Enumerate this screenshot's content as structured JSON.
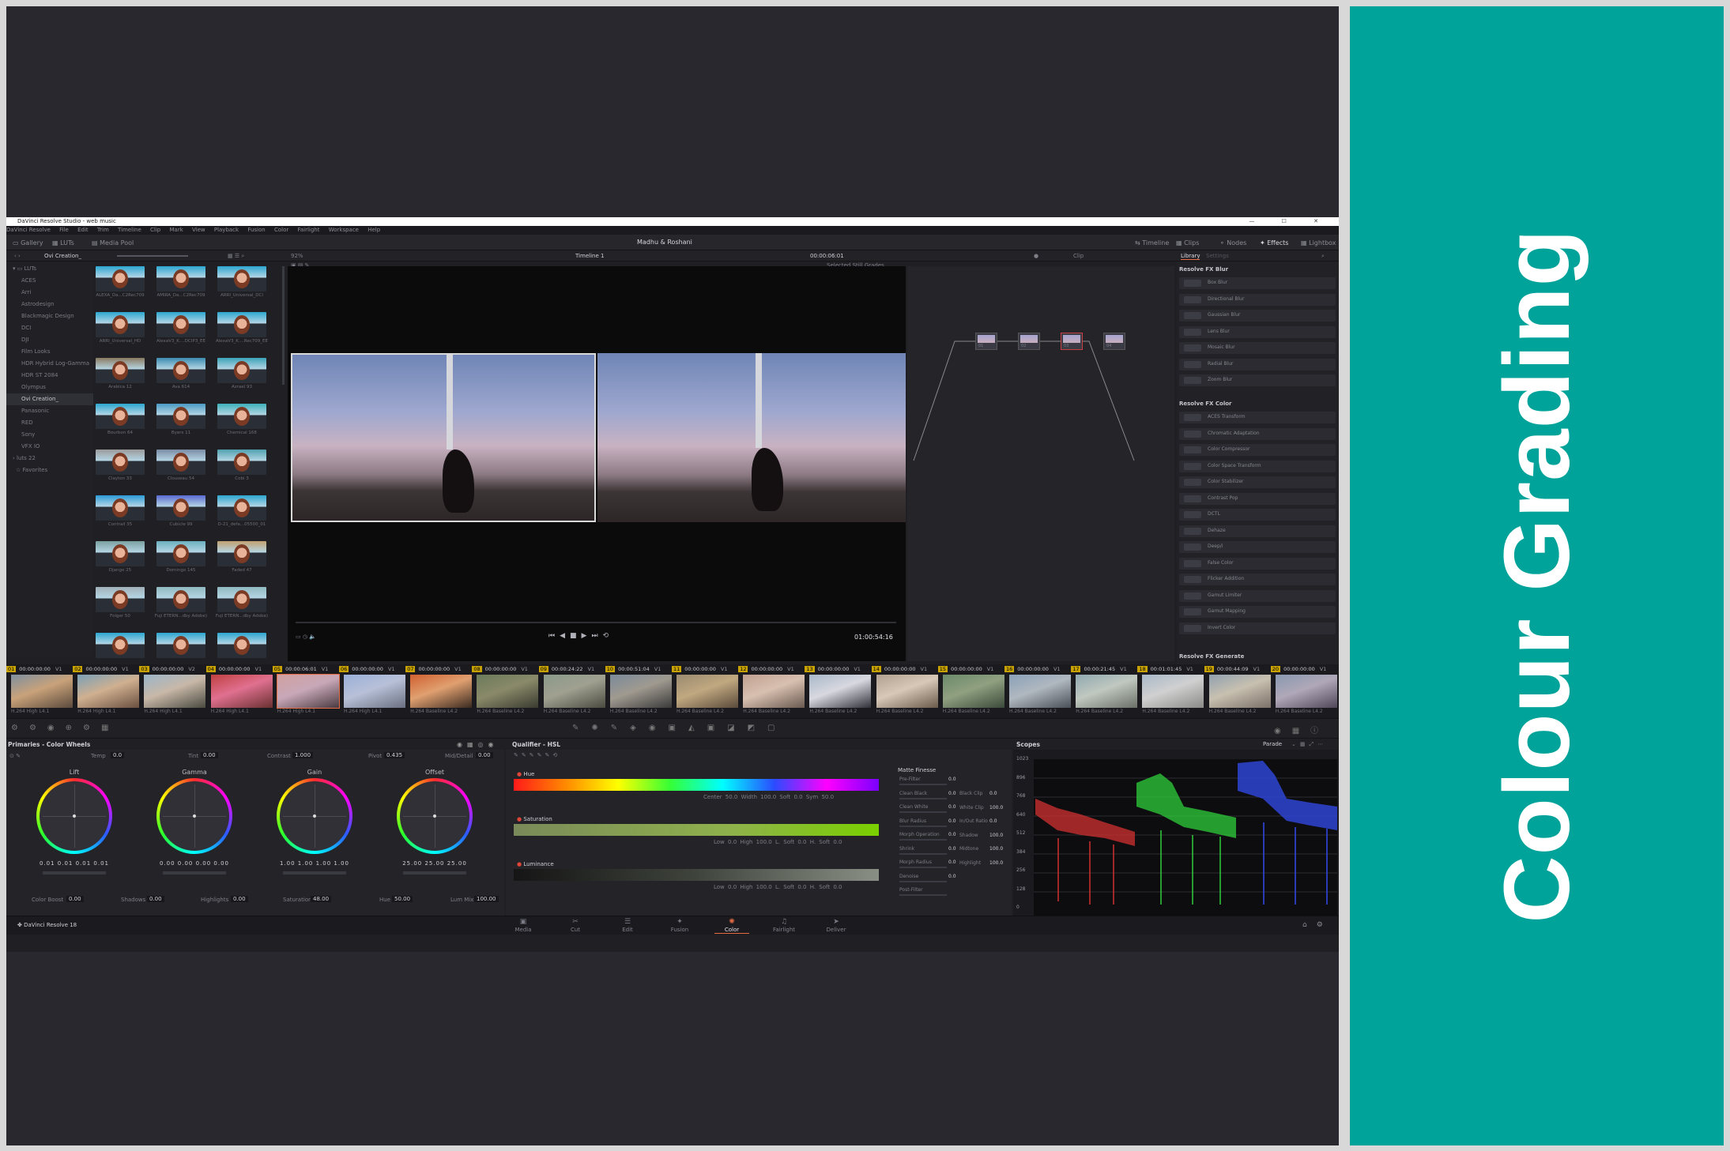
{
  "side_title": "Colour Grading",
  "window": {
    "title": "DaVinci Resolve Studio - web music",
    "controls": "— ☐ ✕"
  },
  "menu": [
    "DaVinci Resolve",
    "File",
    "Edit",
    "Trim",
    "Timeline",
    "Clip",
    "Mark",
    "View",
    "Playback",
    "Fusion",
    "Color",
    "Fairlight",
    "Workspace",
    "Help"
  ],
  "toolbar": {
    "gallery": "Gallery",
    "luts": "LUTs",
    "media_pool": "Media Pool",
    "project_title": "Madhu & Roshani",
    "timeline": "Timeline",
    "clips": "Clips",
    "nodes": "Nodes",
    "effects": "Effects",
    "lightbox": "Lightbox"
  },
  "pane_header": {
    "lut_folder": "Ovi Creation_",
    "zoom": "92%",
    "timeline_name": "Timeline 1",
    "timecode": "00:00:06:01",
    "clip_mode": "Clip",
    "library": "Library",
    "settings": "Settings",
    "selected_stills": "Selected Still Grades"
  },
  "lut_tree": [
    "LUTs",
    "ACES",
    "Arri",
    "Astrodesign",
    "Blackmagic Design",
    "DCI",
    "DJI",
    "Film Looks",
    "HDR Hybrid Log-Gamma",
    "HDR ST 2084",
    "Olympus",
    "Ovi Creation_",
    "Panasonic",
    "RED",
    "Sony",
    "VFX IO",
    "luts 22",
    "Favorites"
  ],
  "lut_selected_index": 11,
  "thumbnails": [
    "ALEXA_Da...C2Rec709",
    "AMIRA_Da...C2Rec709",
    "ARRI_Universal_DCI",
    "ARRI_Universal_HD",
    "AlexaV3_K....DCIP3_EE",
    "AlexaV3_K....Rec709_EE",
    "Arabica 12",
    "Ava 614",
    "Azrael 93",
    "Bourbon 64",
    "Byers 11",
    "Chemical 168",
    "Clayton 33",
    "Clouseau 54",
    "Cobi 3",
    "Contrail 35",
    "Cubicle 99",
    "D-21_defa...05500_01",
    "Django 25",
    "Domingo 145",
    "Faded 47",
    "Folger 50",
    "Fuji ETERN...dby Adobe)",
    "Fuji ETERN...dby Adobe)",
    "",
    "",
    " "
  ],
  "viewer": {
    "timecode": "01:00:54:16"
  },
  "nodes": [
    {
      "label": "01"
    },
    {
      "label": "02"
    },
    {
      "label": "03"
    },
    {
      "label": "04"
    }
  ],
  "fx": {
    "blur_header": "Resolve FX Blur",
    "blur": [
      "Box Blur",
      "Directional Blur",
      "Gaussian Blur",
      "Lens Blur",
      "Mosaic Blur",
      "Radial Blur",
      "Zoom Blur"
    ],
    "color_header": "Resolve FX Color",
    "color": [
      "ACES Transform",
      "Chromatic Adaptation",
      "Color Compressor",
      "Color Space Transform",
      "Color Stabilizer",
      "Contrast Pop",
      "DCTL",
      "Dehaze",
      "Deep/i",
      "False Color",
      "Flicker Addition",
      "Gamut Limiter",
      "Gamut Mapping",
      "Invert Color"
    ],
    "generate_header": "Resolve FX Generate"
  },
  "clips": [
    {
      "n": "01",
      "tc": "00:00:00:00",
      "track": "V1",
      "codec": "H.264 High L4.1"
    },
    {
      "n": "02",
      "tc": "00:00:00:00",
      "track": "V1",
      "codec": "H.264 High L4.1"
    },
    {
      "n": "03",
      "tc": "00:00:00:00",
      "track": "V2",
      "codec": "H.264 High L4.1"
    },
    {
      "n": "04",
      "tc": "00:00:00:00",
      "track": "V1",
      "codec": "H.264 High L4.1"
    },
    {
      "n": "05",
      "tc": "00:00:06:01",
      "track": "V1",
      "codec": "H.264 High L4.1"
    },
    {
      "n": "06",
      "tc": "00:00:00:00",
      "track": "V1",
      "codec": "H.264 High L4.1"
    },
    {
      "n": "07",
      "tc": "00:00:00:00",
      "track": "V1",
      "codec": "H.264 Baseline L4.2"
    },
    {
      "n": "08",
      "tc": "00:00:00:00",
      "track": "V1",
      "codec": "H.264 Baseline L4.2"
    },
    {
      "n": "09",
      "tc": "00:00:24:22",
      "track": "V1",
      "codec": "H.264 Baseline L4.2"
    },
    {
      "n": "10",
      "tc": "00:00:51:04",
      "track": "V1",
      "codec": "H.264 Baseline L4.2"
    },
    {
      "n": "11",
      "tc": "00:00:00:00",
      "track": "V1",
      "codec": "H.264 Baseline L4.2"
    },
    {
      "n": "12",
      "tc": "00:00:00:00",
      "track": "V1",
      "codec": "H.264 Baseline L4.2"
    },
    {
      "n": "13",
      "tc": "00:00:00:00",
      "track": "V1",
      "codec": "H.264 Baseline L4.2"
    },
    {
      "n": "14",
      "tc": "00:00:00:00",
      "track": "V1",
      "codec": "H.264 Baseline L4.2"
    },
    {
      "n": "15",
      "tc": "00:00:00:00",
      "track": "V1",
      "codec": "H.264 Baseline L4.2"
    },
    {
      "n": "16",
      "tc": "00:00:00:00",
      "track": "V1",
      "codec": "H.264 Baseline L4.2"
    },
    {
      "n": "17",
      "tc": "00:00:21:45",
      "track": "V1",
      "codec": "H.264 Baseline L4.2"
    },
    {
      "n": "18",
      "tc": "00:01:01:45",
      "track": "V1",
      "codec": "H.264 Baseline L4.2"
    },
    {
      "n": "19",
      "tc": "00:00:44:09",
      "track": "V1",
      "codec": "H.264 Baseline L4.2"
    },
    {
      "n": "20",
      "tc": "00:00:00:00",
      "track": "V1",
      "codec": "H.264 Baseline L4.2"
    }
  ],
  "primaries": {
    "title": "Primaries - Color Wheels",
    "temp_label": "Temp",
    "temp": "0.0",
    "tint_label": "Tint",
    "tint": "0.00",
    "contrast_label": "Contrast",
    "contrast": "1.000",
    "pivot_label": "Pivot",
    "pivot": "0.435",
    "middetail_label": "Mid/Detail",
    "middetail": "0.00",
    "wheels": [
      {
        "name": "Lift",
        "values": "0.01  0.01  0.01  0.01"
      },
      {
        "name": "Gamma",
        "values": "0.00  0.00  0.00  0.00"
      },
      {
        "name": "Gain",
        "values": "1.00  1.00  1.00  1.00"
      },
      {
        "name": "Offset",
        "values": "25.00  25.00  25.00"
      }
    ],
    "color_boost_label": "Color Boost",
    "color_boost": "0.00",
    "shadows_label": "Shadows",
    "shadows": "0.00",
    "highlights_label": "Highlights",
    "highlights": "0.00",
    "saturation_label": "Saturation",
    "saturation": "48.00",
    "hue_label": "Hue",
    "hue": "50.00",
    "lum_mix_label": "Lum Mix",
    "lum_mix": "100.00"
  },
  "qualifier": {
    "title": "Qualifier - HSL",
    "hue_label": "Hue",
    "sat_label": "Saturation",
    "lum_label": "Luminance",
    "hue_row": "Center  50.0   Width  100.0   Soft  0.0   Sym  50.0",
    "sat_row": "Low  0.0   High  100.0   L. Soft  0.0   H. Soft  0.0",
    "lum_row": "Low  0.0   High  100.0   L. Soft  0.0   H. Soft  0.0",
    "matte_title": "Matte Finesse",
    "matte_items": [
      "Pre-Filter",
      "Clean Black",
      "Clean White",
      "Blur Radius",
      "Morph Operation",
      "Shrink",
      "Morph Radius",
      "Denoise",
      "Post-Filter"
    ],
    "matte_right": [
      "Black Clip",
      "White Clip",
      "In/Out Ratio",
      "Shadow",
      "Midtone",
      "Highlight"
    ],
    "matte_values_left": [
      "0.0",
      "0.0",
      "0.0",
      "0.0",
      "0.0",
      "0.0",
      "0.0",
      "0.0"
    ],
    "matte_values_right": [
      "0.0",
      "100.0",
      "0.0",
      "100.0",
      "100.0",
      "100.0"
    ]
  },
  "scopes": {
    "title": "Scopes",
    "mode": "Parade",
    "ticks": [
      "1023",
      "896",
      "768",
      "640",
      "512",
      "384",
      "256",
      "128",
      "0"
    ]
  },
  "pages": [
    {
      "name": "Media",
      "glyph": "▣"
    },
    {
      "name": "Cut",
      "glyph": "✂"
    },
    {
      "name": "Edit",
      "glyph": "☰"
    },
    {
      "name": "Fusion",
      "glyph": "✦"
    },
    {
      "name": "Color",
      "glyph": "✺"
    },
    {
      "name": "Fairlight",
      "glyph": "♫"
    },
    {
      "name": "Deliver",
      "glyph": "➤"
    }
  ],
  "active_page": "Color",
  "app_name": "DaVinci Resolve 18",
  "colors": {
    "teal": "#00a39a",
    "accent_orange": "#e36b43",
    "clip_number": "#c8a200"
  }
}
